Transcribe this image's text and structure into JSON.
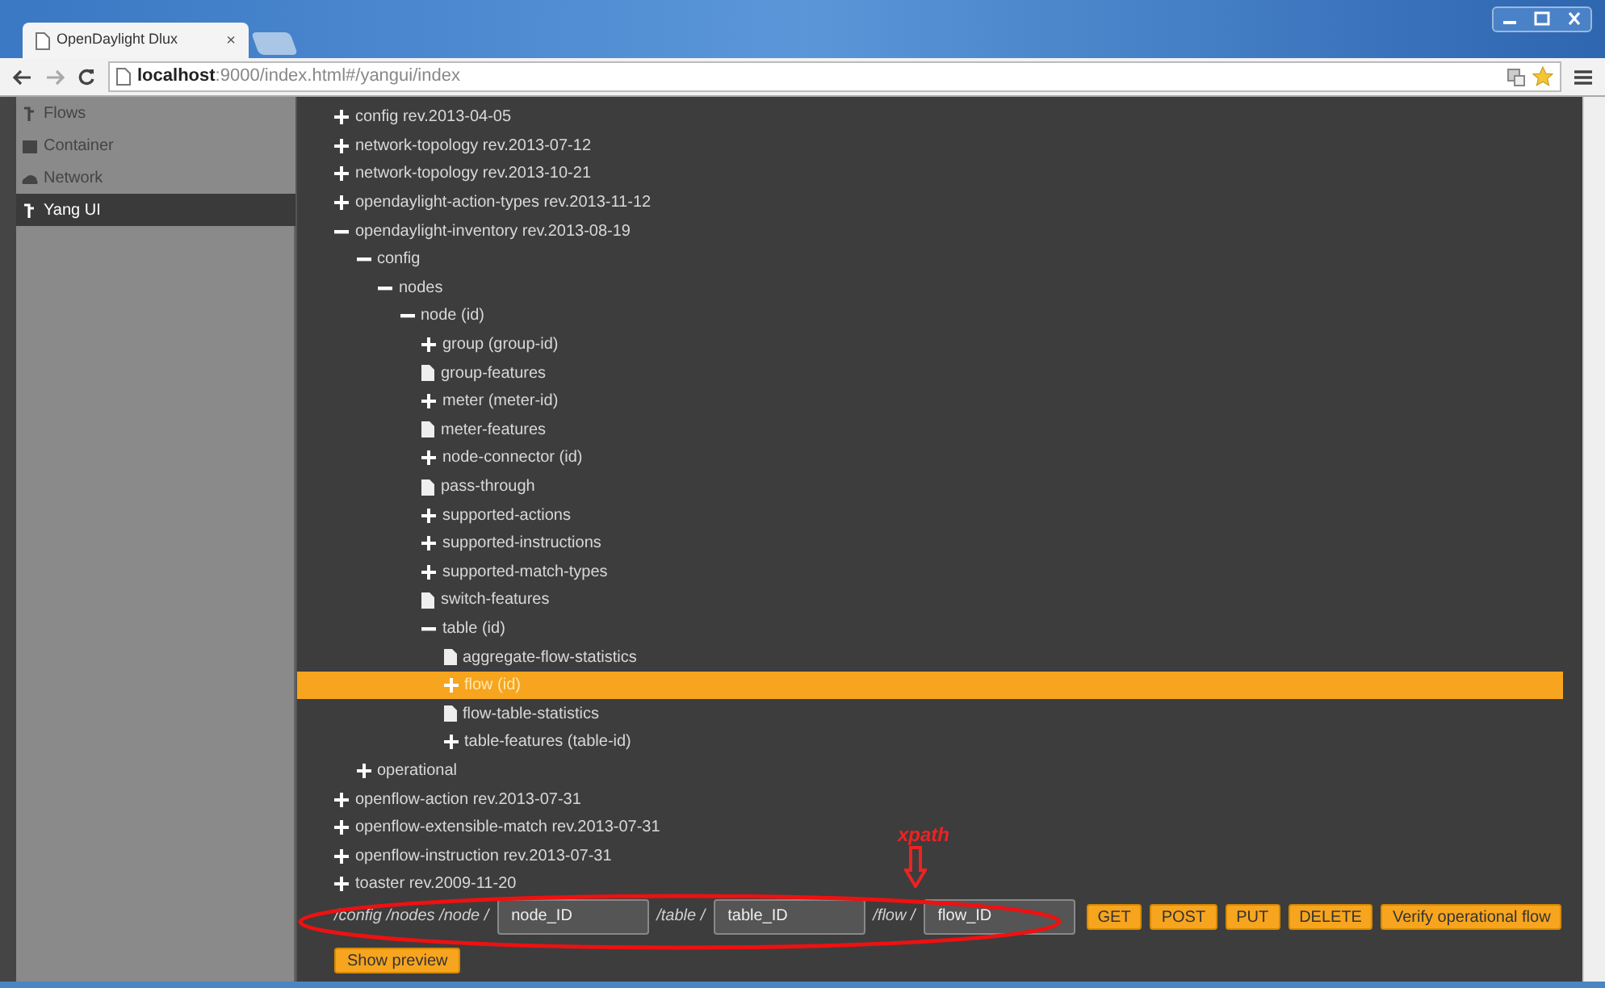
{
  "browser": {
    "tab_title": "OpenDaylight Dlux",
    "tab_close": "×",
    "url_host": "localhost",
    "url_rest": ":9000/index.html#/yangui/index"
  },
  "sidebar": {
    "items": [
      {
        "label": "Flows",
        "selected": false
      },
      {
        "label": "Container",
        "selected": false
      },
      {
        "label": "Network",
        "selected": false
      },
      {
        "label": "Yang UI",
        "selected": true
      }
    ]
  },
  "tree": [
    {
      "label": "config rev.2013-04-05",
      "kind": "node",
      "expanded": false,
      "selected": false
    },
    {
      "label": "network-topology rev.2013-07-12",
      "kind": "node",
      "expanded": false,
      "selected": false
    },
    {
      "label": "network-topology rev.2013-10-21",
      "kind": "node",
      "expanded": false,
      "selected": false
    },
    {
      "label": "opendaylight-action-types rev.2013-11-12",
      "kind": "node",
      "expanded": false,
      "selected": false
    },
    {
      "label": "opendaylight-inventory rev.2013-08-19",
      "kind": "node",
      "expanded": true,
      "selected": false,
      "children": [
        {
          "label": "config",
          "kind": "node",
          "expanded": true,
          "selected": false,
          "children": [
            {
              "label": "nodes",
              "kind": "node",
              "expanded": true,
              "selected": false,
              "children": [
                {
                  "label": "node (id)",
                  "kind": "node",
                  "expanded": true,
                  "selected": false,
                  "children": [
                    {
                      "label": "group (group-id)",
                      "kind": "node",
                      "expanded": false,
                      "selected": false
                    },
                    {
                      "label": "group-features",
                      "kind": "leaf",
                      "selected": false
                    },
                    {
                      "label": "meter (meter-id)",
                      "kind": "node",
                      "expanded": false,
                      "selected": false
                    },
                    {
                      "label": "meter-features",
                      "kind": "leaf",
                      "selected": false
                    },
                    {
                      "label": "node-connector (id)",
                      "kind": "node",
                      "expanded": false,
                      "selected": false
                    },
                    {
                      "label": "pass-through",
                      "kind": "leaf",
                      "selected": false
                    },
                    {
                      "label": "supported-actions",
                      "kind": "node",
                      "expanded": false,
                      "selected": false
                    },
                    {
                      "label": "supported-instructions",
                      "kind": "node",
                      "expanded": false,
                      "selected": false
                    },
                    {
                      "label": "supported-match-types",
                      "kind": "node",
                      "expanded": false,
                      "selected": false
                    },
                    {
                      "label": "switch-features",
                      "kind": "leaf",
                      "selected": false
                    },
                    {
                      "label": "table (id)",
                      "kind": "node",
                      "expanded": true,
                      "selected": false,
                      "children": [
                        {
                          "label": "aggregate-flow-statistics",
                          "kind": "leaf",
                          "selected": false
                        },
                        {
                          "label": "flow (id)",
                          "kind": "node",
                          "expanded": false,
                          "selected": true
                        },
                        {
                          "label": "flow-table-statistics",
                          "kind": "leaf",
                          "selected": false
                        },
                        {
                          "label": "table-features (table-id)",
                          "kind": "node",
                          "expanded": false,
                          "selected": false
                        }
                      ]
                    }
                  ]
                }
              ]
            }
          ]
        },
        {
          "label": "operational",
          "kind": "node",
          "expanded": false,
          "selected": false
        }
      ]
    },
    {
      "label": "openflow-action rev.2013-07-31",
      "kind": "node",
      "expanded": false,
      "selected": false
    },
    {
      "label": "openflow-extensible-match rev.2013-07-31",
      "kind": "node",
      "expanded": false,
      "selected": false
    },
    {
      "label": "openflow-instruction rev.2013-07-31",
      "kind": "node",
      "expanded": false,
      "selected": false
    },
    {
      "label": "toaster rev.2009-11-20",
      "kind": "node",
      "expanded": false,
      "selected": false
    }
  ],
  "path_form": {
    "segments": [
      {
        "prefix": "/config /nodes /node /",
        "value": "node_ID"
      },
      {
        "prefix": "/table /",
        "value": "table_ID"
      },
      {
        "prefix": "/flow /",
        "value": "flow_ID"
      }
    ],
    "buttons": [
      "GET",
      "POST",
      "PUT",
      "DELETE",
      "Verify operational flow"
    ],
    "preview_button": "Show preview"
  },
  "annotation": {
    "label": "xpath"
  }
}
